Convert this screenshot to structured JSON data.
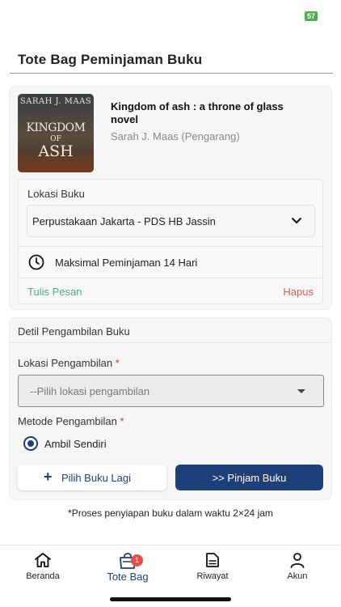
{
  "status": {
    "battery": "57"
  },
  "page": {
    "title": "Tote Bag Peminjaman Buku"
  },
  "book": {
    "cover": {
      "author": "SARAH J. MAAS",
      "title_line1": "KINGDOM",
      "title_line2": "OF",
      "title_line3": "ASH"
    },
    "title": "Kingdom of ash :  a throne of glass novel",
    "author": "Sarah J. Maas (Pengarang)",
    "location_label": "Lokasi Buku",
    "location_value": "Perpustakaan Jakarta - PDS HB Jassin",
    "max_loan": "Maksimal Peminjaman 14 Hari",
    "write_message": "Tulis Pesan",
    "delete": "Hapus"
  },
  "pickup": {
    "header": "Detil Pengambilan Buku",
    "location_label": "Lokasi Pengambilan",
    "location_placeholder": "--Pilih lokasi pengambilan",
    "method_label": "Metode Pengambilan",
    "required_mark": "*",
    "method_option": "Ambil Sendiri",
    "add_more_button": "Pilih Buku Lagi",
    "borrow_button": ">> Pinjam Buku"
  },
  "note": "*Proses penyiapan buku dalam waktu 2×24 jam",
  "nav": {
    "items": [
      {
        "label": "Beranda",
        "icon": "home-icon"
      },
      {
        "label": "Tote Bag",
        "icon": "tote-bag-icon",
        "badge": "1"
      },
      {
        "label": "Riwayat",
        "icon": "document-icon"
      },
      {
        "label": "Akun",
        "icon": "user-icon"
      }
    ]
  },
  "colors": {
    "primary": "#1d3f7a",
    "success": "#4caf78",
    "danger": "#e05a5a",
    "badge": "#e74c4c"
  }
}
